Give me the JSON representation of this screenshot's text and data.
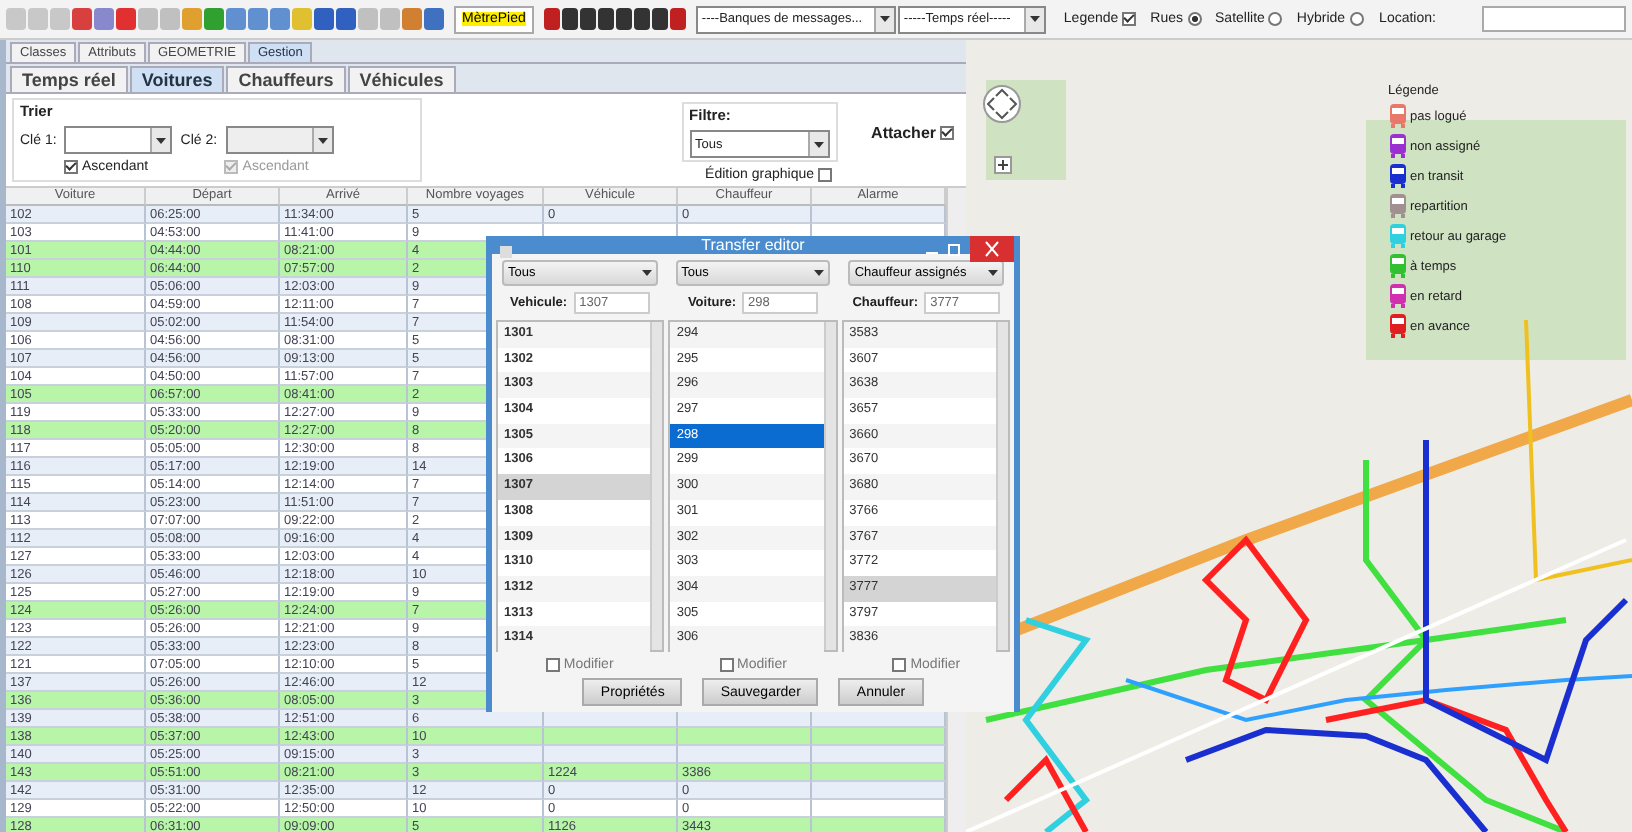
{
  "toolbar": {
    "metre_button": "MètrePied",
    "message_bank": "----Banques de messages...",
    "realtime": "-----Temps réel-----",
    "legend_toggle": {
      "label": "Legende",
      "checked": true
    },
    "map_types": [
      {
        "label": "Rues",
        "selected": true
      },
      {
        "label": "Satellite",
        "selected": false
      },
      {
        "label": "Hybride",
        "selected": false
      }
    ],
    "location_label": "Location:"
  },
  "panel_tabs": [
    {
      "label": "Classes",
      "selected": false
    },
    {
      "label": "Attributs",
      "selected": false
    },
    {
      "label": "GEOMETRIE",
      "selected": false
    },
    {
      "label": "Gestion",
      "selected": true
    }
  ],
  "sub_tabs": [
    {
      "label": "Temps réel",
      "selected": false
    },
    {
      "label": "Voitures",
      "selected": true
    },
    {
      "label": "Chauffeurs",
      "selected": false
    },
    {
      "label": "Véhicules",
      "selected": false
    }
  ],
  "sort": {
    "title": "Trier",
    "key1_label": "Clé 1:",
    "key2_label": "Clé 2:",
    "key1_ascending": {
      "label": "Ascendant",
      "checked": true,
      "disabled": false
    },
    "key2_ascending": {
      "label": "Ascendant",
      "checked": true,
      "disabled": true
    }
  },
  "filter": {
    "title": "Filtre:",
    "value": "Tous",
    "attach": {
      "label": "Attacher",
      "checked": true
    },
    "graphic_edit": {
      "label": "Édition graphique",
      "checked": false
    }
  },
  "table": {
    "columns": [
      "Voiture",
      "Départ",
      "Arrivé",
      "Nombre voyages",
      "Véhicule",
      "Chauffeur",
      "Alarme"
    ],
    "rows": [
      {
        "cells": [
          "102",
          "06:25:00",
          "11:34:00",
          "5",
          "0",
          "0"
        ],
        "highlighted": false
      },
      {
        "cells": [
          "103",
          "04:53:00",
          "11:41:00",
          "9"
        ],
        "highlighted": false
      },
      {
        "cells": [
          "101",
          "04:44:00",
          "08:21:00",
          "4"
        ],
        "highlighted": true
      },
      {
        "cells": [
          "110",
          "06:44:00",
          "07:57:00",
          "2"
        ],
        "highlighted": true
      },
      {
        "cells": [
          "111",
          "05:06:00",
          "12:03:00",
          "9"
        ],
        "highlighted": false
      },
      {
        "cells": [
          "108",
          "04:59:00",
          "12:11:00",
          "7"
        ],
        "highlighted": false
      },
      {
        "cells": [
          "109",
          "05:02:00",
          "11:54:00",
          "7"
        ],
        "highlighted": false
      },
      {
        "cells": [
          "106",
          "04:56:00",
          "08:31:00",
          "5"
        ],
        "highlighted": false
      },
      {
        "cells": [
          "107",
          "04:56:00",
          "09:13:00",
          "5"
        ],
        "highlighted": false
      },
      {
        "cells": [
          "104",
          "04:50:00",
          "11:57:00",
          "7"
        ],
        "highlighted": false
      },
      {
        "cells": [
          "105",
          "06:57:00",
          "08:41:00",
          "2"
        ],
        "highlighted": true
      },
      {
        "cells": [
          "119",
          "05:33:00",
          "12:27:00",
          "9"
        ],
        "highlighted": false
      },
      {
        "cells": [
          "118",
          "05:20:00",
          "12:27:00",
          "8"
        ],
        "highlighted": true
      },
      {
        "cells": [
          "117",
          "05:05:00",
          "12:30:00",
          "8"
        ],
        "highlighted": false
      },
      {
        "cells": [
          "116",
          "05:17:00",
          "12:19:00",
          "14"
        ],
        "highlighted": false
      },
      {
        "cells": [
          "115",
          "05:14:00",
          "12:14:00",
          "7"
        ],
        "highlighted": false
      },
      {
        "cells": [
          "114",
          "05:23:00",
          "11:51:00",
          "7"
        ],
        "highlighted": false
      },
      {
        "cells": [
          "113",
          "07:07:00",
          "09:22:00",
          "2"
        ],
        "highlighted": false
      },
      {
        "cells": [
          "112",
          "05:08:00",
          "09:16:00",
          "4"
        ],
        "highlighted": false
      },
      {
        "cells": [
          "127",
          "05:33:00",
          "12:03:00",
          "4"
        ],
        "highlighted": false
      },
      {
        "cells": [
          "126",
          "05:46:00",
          "12:18:00",
          "10"
        ],
        "highlighted": false
      },
      {
        "cells": [
          "125",
          "05:27:00",
          "12:19:00",
          "9"
        ],
        "highlighted": false
      },
      {
        "cells": [
          "124",
          "05:26:00",
          "12:24:00",
          "7"
        ],
        "highlighted": true
      },
      {
        "cells": [
          "123",
          "05:26:00",
          "12:21:00",
          "9"
        ],
        "highlighted": false
      },
      {
        "cells": [
          "122",
          "05:33:00",
          "12:23:00",
          "8"
        ],
        "highlighted": false
      },
      {
        "cells": [
          "121",
          "07:05:00",
          "12:10:00",
          "5"
        ],
        "highlighted": false
      },
      {
        "cells": [
          "137",
          "05:26:00",
          "12:46:00",
          "12"
        ],
        "highlighted": false
      },
      {
        "cells": [
          "136",
          "05:36:00",
          "08:05:00",
          "3"
        ],
        "highlighted": true
      },
      {
        "cells": [
          "139",
          "05:38:00",
          "12:51:00",
          "6"
        ],
        "highlighted": false
      },
      {
        "cells": [
          "138",
          "05:37:00",
          "12:43:00",
          "10"
        ],
        "highlighted": true
      },
      {
        "cells": [
          "140",
          "05:25:00",
          "09:15:00",
          "3"
        ],
        "highlighted": false
      },
      {
        "cells": [
          "143",
          "05:51:00",
          "08:21:00",
          "3",
          "1224",
          "3386"
        ],
        "highlighted": true
      },
      {
        "cells": [
          "142",
          "05:31:00",
          "12:35:00",
          "12",
          "0",
          "0"
        ],
        "highlighted": false
      },
      {
        "cells": [
          "129",
          "05:22:00",
          "12:50:00",
          "10",
          "0",
          "0"
        ],
        "highlighted": false
      },
      {
        "cells": [
          "128",
          "06:31:00",
          "09:09:00",
          "5",
          "1126",
          "3443"
        ],
        "highlighted": true
      }
    ]
  },
  "legend": {
    "title": "Légende",
    "items": [
      {
        "label": "pas logué",
        "color": "#e8786a"
      },
      {
        "label": "non assigné",
        "color": "#9b30d0"
      },
      {
        "label": "en transit",
        "color": "#1a2fd0"
      },
      {
        "label": "repartition",
        "color": "#a09090"
      },
      {
        "label": "retour au garage",
        "color": "#30d0e0"
      },
      {
        "label": "à temps",
        "color": "#30c030"
      },
      {
        "label": "en retard",
        "color": "#d030b0"
      },
      {
        "label": "en avance",
        "color": "#e02020"
      }
    ]
  },
  "dialog": {
    "title": "Transfer editor",
    "filters": [
      "Tous",
      "Tous",
      "Chauffeur assignés"
    ],
    "fields": [
      {
        "label": "Vehicule:",
        "value": "1307"
      },
      {
        "label": "Voiture:",
        "value": "298"
      },
      {
        "label": "Chauffeur:",
        "value": "3777"
      }
    ],
    "lists": [
      {
        "kind": "vehicle",
        "items": [
          {
            "label": "1301",
            "selected": false
          },
          {
            "label": "1302",
            "selected": false
          },
          {
            "label": "1303",
            "selected": false
          },
          {
            "label": "1304",
            "selected": false
          },
          {
            "label": "1305",
            "selected": false
          },
          {
            "label": "1306",
            "selected": false
          },
          {
            "label": "1307",
            "selected": true
          },
          {
            "label": "1308",
            "selected": false
          },
          {
            "label": "1309",
            "selected": false
          },
          {
            "label": "1310",
            "selected": false
          },
          {
            "label": "1312",
            "selected": false
          },
          {
            "label": "1313",
            "selected": false
          },
          {
            "label": "1314",
            "selected": false
          }
        ]
      },
      {
        "kind": "car",
        "items": [
          {
            "label": "294",
            "selected": false
          },
          {
            "label": "295",
            "selected": false
          },
          {
            "label": "296",
            "selected": false
          },
          {
            "label": "297",
            "selected": false
          },
          {
            "label": "298",
            "selected": true
          },
          {
            "label": "299",
            "selected": false
          },
          {
            "label": "300",
            "selected": false
          },
          {
            "label": "301",
            "selected": false
          },
          {
            "label": "302",
            "selected": false
          },
          {
            "label": "303",
            "selected": false
          },
          {
            "label": "304",
            "selected": false
          },
          {
            "label": "305",
            "selected": false
          },
          {
            "label": "306",
            "selected": false
          }
        ]
      },
      {
        "kind": "driver",
        "items": [
          {
            "label": "3583",
            "selected": false
          },
          {
            "label": "3607",
            "selected": false
          },
          {
            "label": "3638",
            "selected": false
          },
          {
            "label": "3657",
            "selected": false
          },
          {
            "label": "3660",
            "selected": false
          },
          {
            "label": "3670",
            "selected": false
          },
          {
            "label": "3680",
            "selected": false
          },
          {
            "label": "3766",
            "selected": false
          },
          {
            "label": "3767",
            "selected": false
          },
          {
            "label": "3772",
            "selected": false
          },
          {
            "label": "3777",
            "selected": true
          },
          {
            "label": "3797",
            "selected": false
          },
          {
            "label": "3836",
            "selected": false
          }
        ]
      }
    ],
    "modify": [
      {
        "label": "Modifier",
        "checked": false
      },
      {
        "label": "Modifier",
        "checked": false
      },
      {
        "label": "Modifier",
        "checked": false
      }
    ],
    "buttons": [
      "Propriétés",
      "Sauvegarder",
      "Annuler"
    ]
  }
}
